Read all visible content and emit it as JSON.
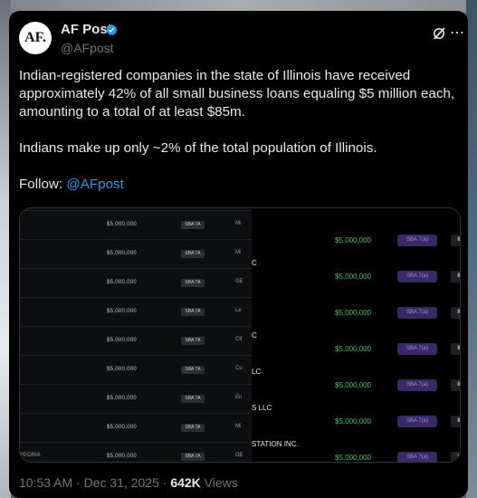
{
  "post": {
    "author_name": "AF Post",
    "avatar_text": "AF.",
    "handle": "@AFpost",
    "body_lines": [
      "Indian-registered companies in the state of Illinois have received",
      "approximately 42% of all small business loans equaling $5 million each,",
      "amounting to a total of at least $85m."
    ],
    "body_line2": "Indians make up only ~2% of the total population of Illinois.",
    "follow_prefix": "Follow: ",
    "follow_link": "@AFpost",
    "time": "10:53 AM · Dec 31, 2025 · ",
    "views_count": "642K",
    "views_label": " Views"
  },
  "icons": {
    "verified": "verified-badge-icon",
    "grok": "grok-icon",
    "more": "more-icon"
  },
  "colors": {
    "link": "#1d9bf0",
    "verified": "#1d9bf0",
    "amount": "#43c15b",
    "sba_badge": "#3a2a63"
  },
  "media": {
    "left_rows": [
      {
        "amount": "$5,000,000",
        "program": "SBA 7A",
        "name": "Mi",
        "prefix": ""
      },
      {
        "amount": "$5,000,000",
        "program": "SBA 7A",
        "name": "Mi",
        "prefix": ""
      },
      {
        "amount": "$5,000,000",
        "program": "SBA 7A",
        "name": "GE",
        "prefix": ""
      },
      {
        "amount": "$5,000,000",
        "program": "SBA 7A",
        "name": "Le",
        "prefix": ""
      },
      {
        "amount": "$5,000,000",
        "program": "SBA 7A",
        "name": "Cit",
        "prefix": ""
      },
      {
        "amount": "$5,000,000",
        "program": "SBA 7A",
        "name": "Co",
        "prefix": ""
      },
      {
        "amount": "$5,000,000",
        "program": "SBA 7A",
        "name": "En",
        "prefix": ""
      },
      {
        "amount": "$5,000,000",
        "program": "SBA 7A",
        "name": "Mi",
        "prefix": ""
      },
      {
        "amount": "$5,000,000",
        "program": "SBA 7A",
        "name": "GE",
        "prefix": "PEORIA"
      }
    ],
    "right_rows": [
      {
        "name": "",
        "amount": "$5,000,000",
        "program": "SBA 7(a)",
        "state": "IL"
      },
      {
        "name": "C",
        "amount": "$5,000,000",
        "program": "SBA 7(a)",
        "state": "IL"
      },
      {
        "name": "",
        "amount": "$5,000,000",
        "program": "SBA 7(a)",
        "state": "IL"
      },
      {
        "name": "C",
        "amount": "$5,000,000",
        "program": "SBA 7(a)",
        "state": "IL"
      },
      {
        "name": "LC",
        "amount": "$5,000,000",
        "program": "SBA 7(a)",
        "state": "IL"
      },
      {
        "name": "S LLC",
        "amount": "$5,000,000",
        "program": "SBA 7(a)",
        "state": "IL"
      },
      {
        "name": "STATION INC.",
        "amount": "$5,000,000",
        "program": "SBA 7(a)",
        "state": "IL"
      }
    ]
  }
}
